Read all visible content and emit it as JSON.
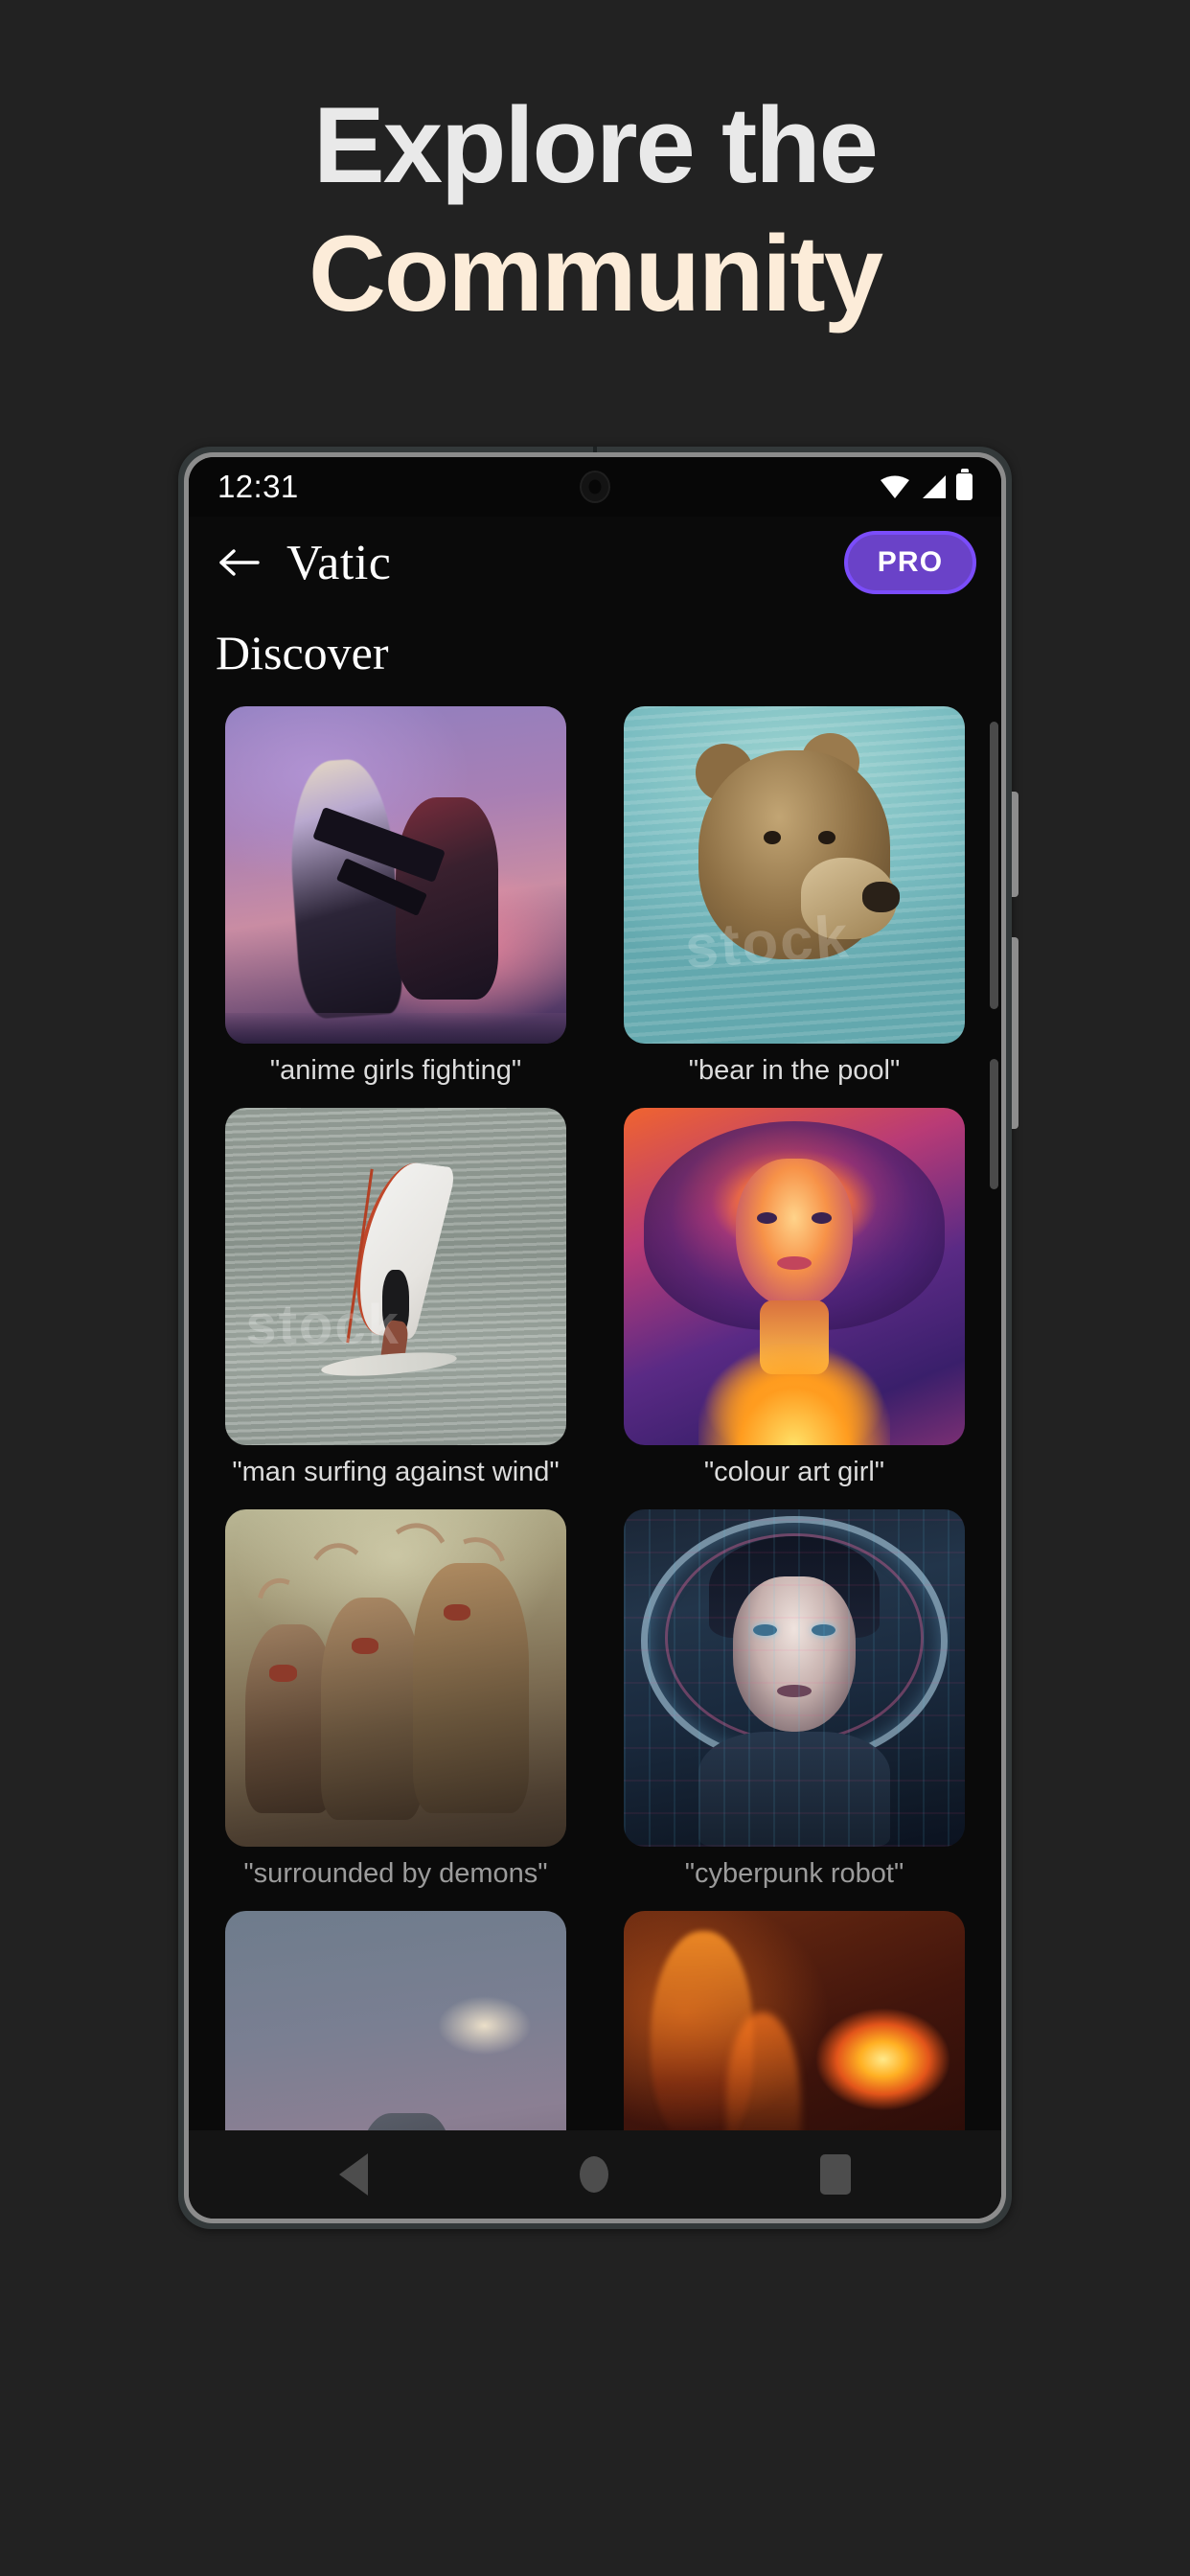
{
  "promo": {
    "line1": "Explore the",
    "line2": "Community",
    "line1_color": "#e9e9e9",
    "line2_color": "#fcecd9",
    "background": "#222222"
  },
  "phone": {
    "status_bar": {
      "time": "12:31",
      "icons": [
        "wifi-icon",
        "cellular-signal-icon",
        "battery-icon"
      ]
    },
    "app_bar": {
      "back_icon": "back-arrow-icon",
      "title": "Vatic",
      "pro_label": "PRO",
      "pro_color": "#6a42c8",
      "pro_border_color": "#7b4dfb"
    },
    "section_title": "Discover",
    "grid": [
      {
        "caption": "\"anime girls fighting\"",
        "art": "anime",
        "dim": false
      },
      {
        "caption": "\"bear in the pool\"",
        "art": "bear",
        "dim": false
      },
      {
        "caption": "\"man surfing against wind\"",
        "art": "surf",
        "dim": false
      },
      {
        "caption": "\"colour art girl\"",
        "art": "colour",
        "dim": false
      },
      {
        "caption": "\"surrounded by demons\"",
        "art": "demons",
        "dim": true
      },
      {
        "caption": "\"cyberpunk robot\"",
        "art": "cyber",
        "dim": true
      },
      {
        "caption": "",
        "art": "misty",
        "dim": false
      },
      {
        "caption": "",
        "art": "fire",
        "dim": false
      }
    ],
    "nav_bar": {
      "back": "nav-back-icon",
      "home": "nav-home-icon",
      "recents": "nav-recents-icon"
    }
  },
  "watermarks": {
    "bear": "stock",
    "surf": "stock"
  }
}
